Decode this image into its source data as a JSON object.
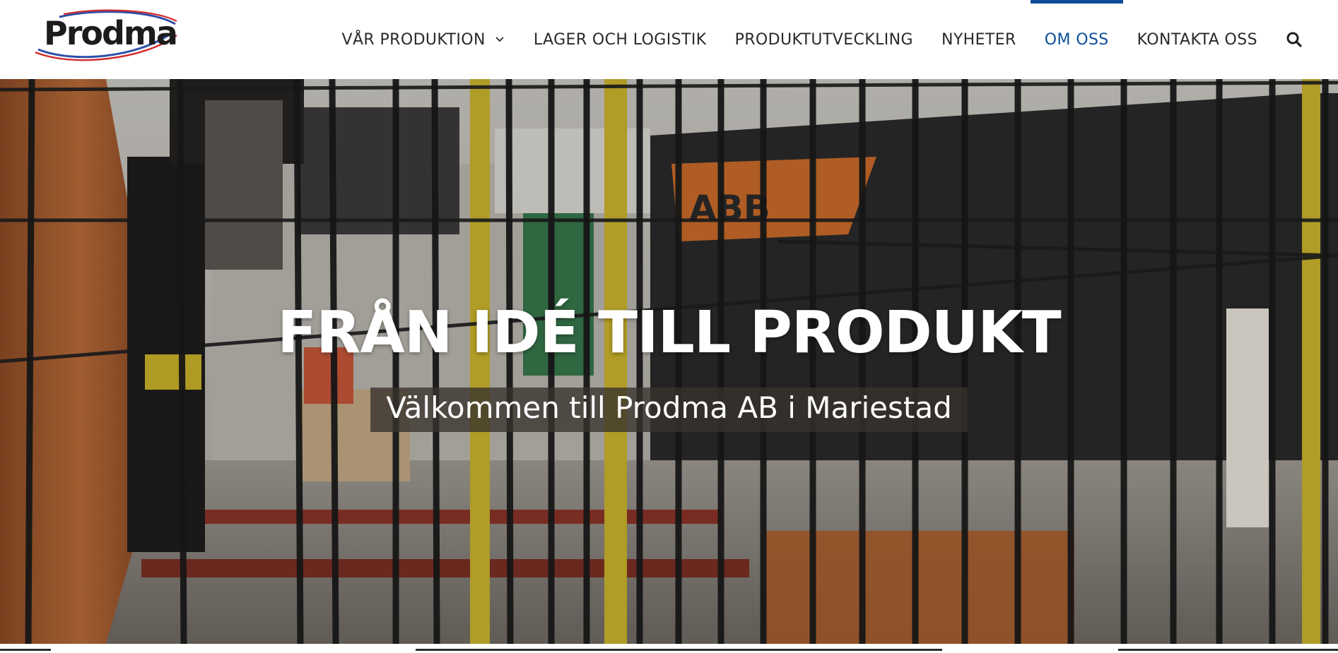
{
  "brand": {
    "logo_text": "Prodma",
    "colors": {
      "primary_blue": "#0d4d9b",
      "logo_swoosh_blue": "#2d4ea8",
      "logo_swoosh_red": "#d42b2b"
    }
  },
  "nav": {
    "items": [
      {
        "label": "VÅR PRODUKTION",
        "has_dropdown": true,
        "active": false
      },
      {
        "label": "LAGER OCH LOGISTIK",
        "has_dropdown": false,
        "active": false
      },
      {
        "label": "PRODUKTUTVECKLING",
        "has_dropdown": false,
        "active": false
      },
      {
        "label": "NYHETER",
        "has_dropdown": false,
        "active": false
      },
      {
        "label": "OM OSS",
        "has_dropdown": false,
        "active": true
      },
      {
        "label": "KONTAKTA OSS",
        "has_dropdown": false,
        "active": false
      }
    ],
    "search_icon": "search-icon",
    "dropdown_icon": "chevron-down-icon"
  },
  "hero": {
    "title": "FRÅN IDÉ TILL PRODUKT",
    "subtitle": "Välkommen till Prodma AB i Mariestad"
  }
}
